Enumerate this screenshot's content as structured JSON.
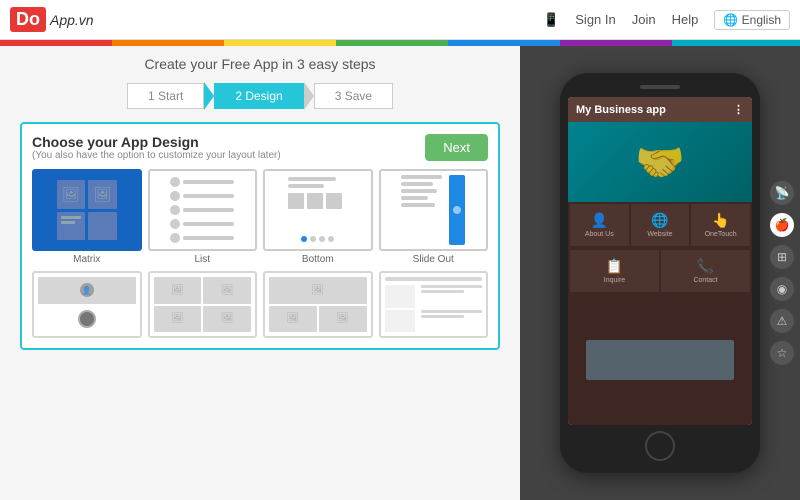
{
  "nav": {
    "logo_do": "Do",
    "logo_text": "App.vn",
    "sign_in": "Sign In",
    "join": "Join",
    "help": "Help",
    "language": "🌐 English",
    "device_icon": "📱"
  },
  "page": {
    "title": "Create your Free App in 3 easy steps"
  },
  "steps": [
    {
      "label": "1 Start",
      "active": false
    },
    {
      "label": "2 Design",
      "active": true
    },
    {
      "label": "3 Save",
      "active": false
    }
  ],
  "design_panel": {
    "title": "Choose your App Design",
    "subtitle": "(You also have the option to customize your layout later)",
    "next_button": "Next"
  },
  "layouts": [
    {
      "id": "matrix",
      "label": "Matrix",
      "selected": true
    },
    {
      "id": "list",
      "label": "List",
      "selected": false
    },
    {
      "id": "bottom",
      "label": "Bottom",
      "selected": false
    },
    {
      "id": "slideout",
      "label": "Slide Out",
      "selected": false
    }
  ],
  "phone": {
    "app_title": "My Business app",
    "menu_icon": "⋮",
    "buttons": [
      {
        "icon": "👤",
        "label": "About Us"
      },
      {
        "icon": "🌐",
        "label": "Website"
      },
      {
        "icon": "👆",
        "label": "OneTouch"
      },
      {
        "icon": "📋",
        "label": "Inquire"
      },
      {
        "icon": "📞",
        "label": "Contact"
      }
    ]
  },
  "side_icons": [
    {
      "id": "wifi",
      "symbol": "📡",
      "active": false
    },
    {
      "id": "apple",
      "symbol": "🍎",
      "active": true
    },
    {
      "id": "windows",
      "symbol": "⊞",
      "active": false
    },
    {
      "id": "android",
      "symbol": "◉",
      "active": false
    },
    {
      "id": "warning",
      "symbol": "⚠",
      "active": false
    },
    {
      "id": "star",
      "symbol": "☆",
      "active": false
    }
  ]
}
